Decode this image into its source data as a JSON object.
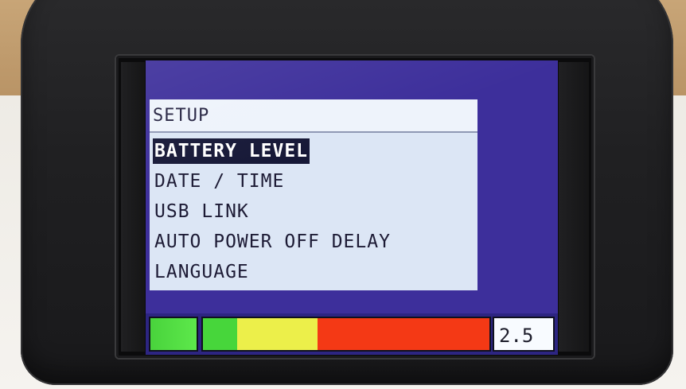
{
  "screen": {
    "menu": {
      "title": "SETUP",
      "items": [
        {
          "label": "BATTERY LEVEL",
          "selected": true
        },
        {
          "label": "DATE / TIME",
          "selected": false
        },
        {
          "label": "USB LINK",
          "selected": false
        },
        {
          "label": "AUTO POWER OFF DELAY",
          "selected": false
        },
        {
          "label": "LANGUAGE",
          "selected": false
        }
      ]
    },
    "status_bar": {
      "value": "2.5"
    }
  },
  "colors": {
    "screen_background": "#3d2f9b",
    "menu_background": "#dce6f5",
    "title_background": "#eef3fb",
    "selection_background": "#161837",
    "gauge_green": "#47d63b",
    "gauge_yellow": "#ecef4a",
    "gauge_red": "#f43915",
    "indicator_green": "#5de84b"
  }
}
